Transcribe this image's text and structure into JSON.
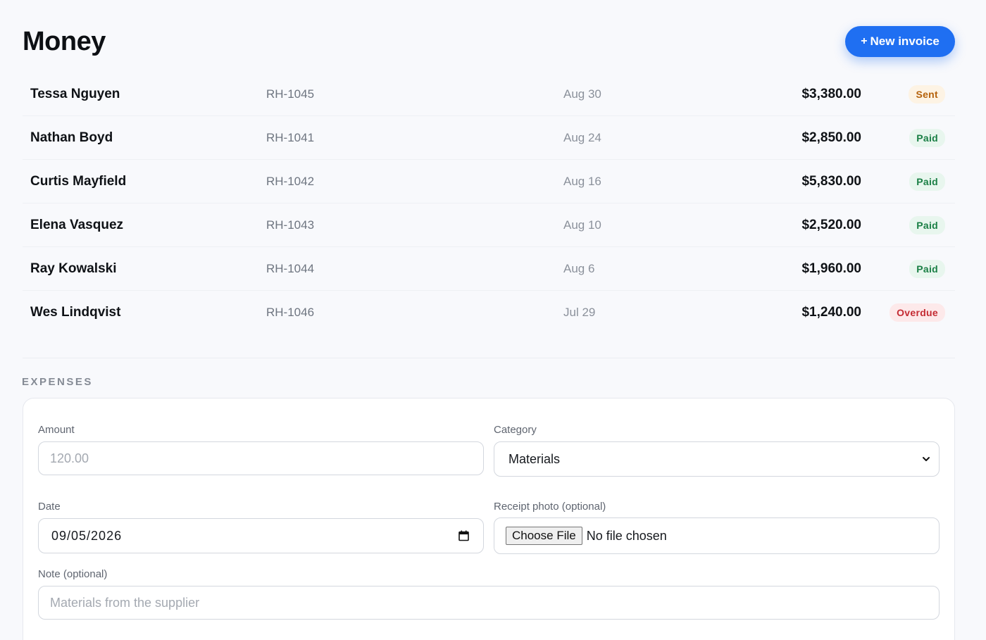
{
  "header": {
    "title": "Money",
    "new_invoice_plus": "+",
    "new_invoice_label": "New invoice"
  },
  "invoices": [
    {
      "client": "Tessa Nguyen",
      "id": "RH-1045",
      "date": "Aug 30",
      "amount": "$3,380.00",
      "status": "Sent"
    },
    {
      "client": "Nathan Boyd",
      "id": "RH-1041",
      "date": "Aug 24",
      "amount": "$2,850.00",
      "status": "Paid"
    },
    {
      "client": "Curtis Mayfield",
      "id": "RH-1042",
      "date": "Aug 16",
      "amount": "$5,830.00",
      "status": "Paid"
    },
    {
      "client": "Elena Vasquez",
      "id": "RH-1043",
      "date": "Aug 10",
      "amount": "$2,520.00",
      "status": "Paid"
    },
    {
      "client": "Ray Kowalski",
      "id": "RH-1044",
      "date": "Aug 6",
      "amount": "$1,960.00",
      "status": "Paid"
    },
    {
      "client": "Wes Lindqvist",
      "id": "RH-1046",
      "date": "Jul 29",
      "amount": "$1,240.00",
      "status": "Overdue"
    }
  ],
  "status_colors": {
    "Sent": {
      "bg": "#fdf3e4",
      "fg": "#b5620c"
    },
    "Paid": {
      "bg": "#e8f6ee",
      "fg": "#1a7f45"
    },
    "Overdue": {
      "bg": "#fde9ea",
      "fg": "#c42b33"
    }
  },
  "expenses": {
    "section_label": "EXPENSES",
    "amount_label": "Amount",
    "amount_placeholder": "120.00",
    "category_label": "Category",
    "category_value": "Materials",
    "date_label": "Date",
    "date_value": "09/05/2026",
    "receipt_label": "Receipt photo (optional)",
    "choose_file_label": "Choose File",
    "no_file_text": "No file chosen",
    "note_label": "Note (optional)",
    "note_placeholder": "Materials from the supplier"
  },
  "colors": {
    "accent": "#1f6ff2",
    "background": "#f8f9fc"
  }
}
